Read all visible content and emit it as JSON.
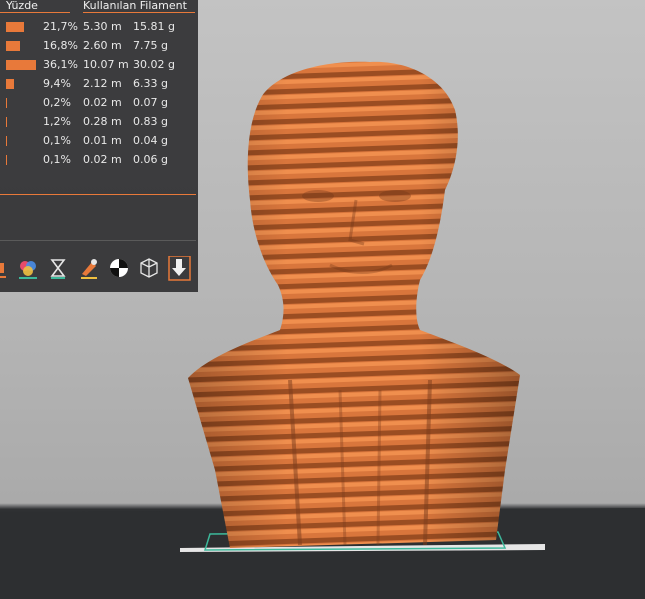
{
  "panel": {
    "headers": {
      "percent": "Yüzde",
      "used_filament": "Kullanılan Filament"
    },
    "rows": [
      {
        "percent": "21,7%",
        "length": "5.30 m",
        "weight": "15.81 g",
        "share": 0.217
      },
      {
        "percent": "16,8%",
        "length": "2.60 m",
        "weight": "7.75 g",
        "share": 0.168
      },
      {
        "percent": "36,1%",
        "length": "10.07 m",
        "weight": "30.02 g",
        "share": 0.361
      },
      {
        "percent": "9,4%",
        "length": "2.12 m",
        "weight": "6.33 g",
        "share": 0.094
      },
      {
        "percent": "0,2%",
        "length": "0.02 m",
        "weight": "0.07 g",
        "share": 0.002
      },
      {
        "percent": "1,2%",
        "length": "0.28 m",
        "weight": "0.83 g",
        "share": 0.012
      },
      {
        "percent": "0,1%",
        "length": "0.01 m",
        "weight": "0.04 g",
        "share": 0.001
      },
      {
        "percent": "0,1%",
        "length": "0.02 m",
        "weight": "0.06 g",
        "share": 0.001
      }
    ],
    "toolbar_icons": [
      "line-type-icon",
      "color-print-icon",
      "print-time-icon",
      "paint-brush-icon",
      "filament-color-icon",
      "wireframe-cube-icon",
      "export-download-icon"
    ]
  },
  "colors": {
    "accent": "#e8793a",
    "panel_bg": "#363638",
    "model_orange": "#d8733a",
    "model_dark_band": "#8a4520",
    "bed": "#2b2d2f"
  }
}
